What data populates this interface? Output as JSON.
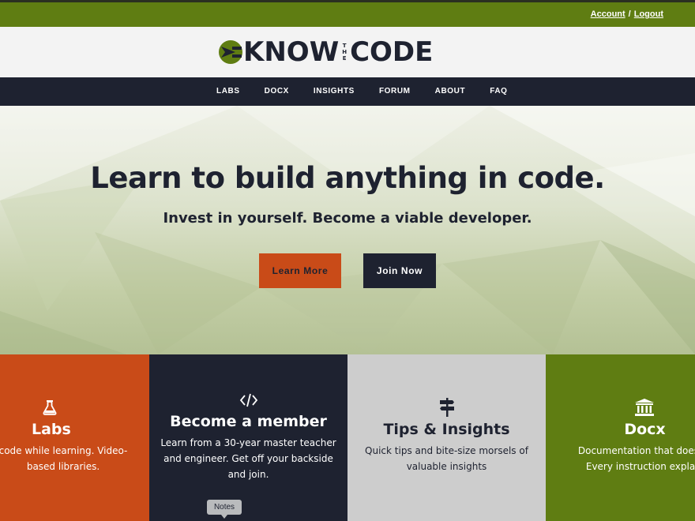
{
  "topbar": {
    "account_label": "Account",
    "separator": "/",
    "logout_label": "Logout"
  },
  "logo": {
    "word_know": "KNOW",
    "the_letters": [
      "T",
      "H",
      "E"
    ],
    "word_code": "CODE"
  },
  "nav": {
    "items": [
      "LABS",
      "DOCX",
      "INSIGHTS",
      "FORUM",
      "ABOUT",
      "FAQ"
    ]
  },
  "hero": {
    "headline": "Learn to build anything in code.",
    "subheadline": "Invest in yourself. Become a viable developer.",
    "learn_more_label": "Learn More",
    "join_now_label": "Join Now"
  },
  "tiles": {
    "labs": {
      "title": "Labs",
      "desc_line1": "code while learning. Video-",
      "desc_line2": "based libraries.",
      "icon": "flask-icon"
    },
    "member": {
      "title": "Become a member",
      "desc_line1": "Learn from a 30-year master teacher",
      "desc_line2": "and engineer. Get off your backside",
      "desc_line3": "and join.",
      "icon": "code-icon"
    },
    "tips": {
      "title": "Tips & Insights",
      "desc_line1": "Quick tips and bite-size morsels of",
      "desc_line2": "valuable insights",
      "icon": "signpost-icon"
    },
    "docx": {
      "title": "Docx",
      "desc_line1": "Documentation that doesn’t",
      "desc_line2": "Every instruction explain",
      "icon": "library-icon"
    }
  },
  "tooltip": {
    "notes_label": "Notes"
  },
  "colors": {
    "brand_green": "#5f7d12",
    "navy": "#1e2230",
    "orange": "#c94b18",
    "gray_tile": "#cdcdcd"
  }
}
